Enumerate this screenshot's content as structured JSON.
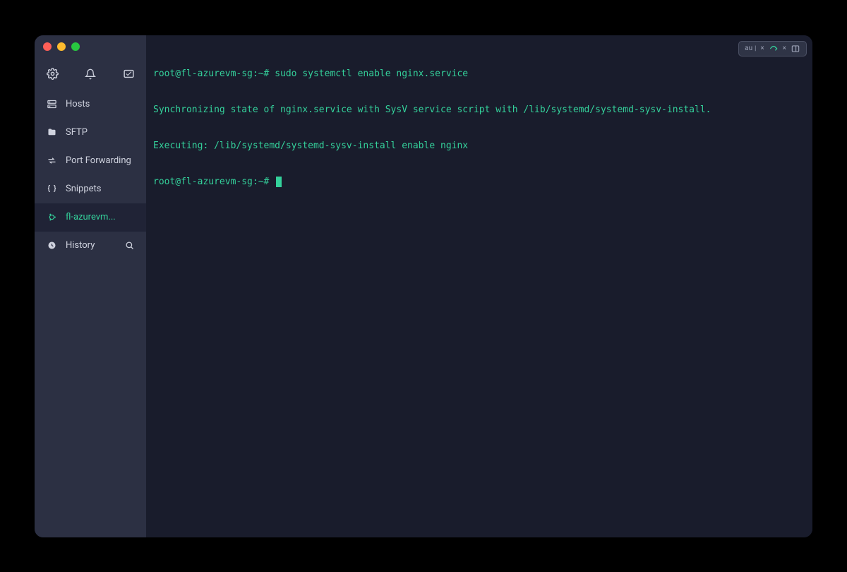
{
  "colors": {
    "bg_outer": "#000000",
    "sidebar_bg": "#2c3043",
    "main_bg": "#191c2c",
    "text_default": "#d0d3df",
    "accent_green": "#34d19b"
  },
  "traffic": {
    "close": "close",
    "minimize": "minimize",
    "maximize": "maximize"
  },
  "top_icons": {
    "settings": "Settings",
    "notifications": "Notifications",
    "snapshot": "Snapshot"
  },
  "sidebar": {
    "items": [
      {
        "id": "hosts",
        "label": "Hosts",
        "active": false
      },
      {
        "id": "sftp",
        "label": "SFTP",
        "active": false
      },
      {
        "id": "port-forwarding",
        "label": "Port Forwarding",
        "active": false
      },
      {
        "id": "snippets",
        "label": "Snippets",
        "active": false
      },
      {
        "id": "connection",
        "label": "fl-azurevm...",
        "active": true
      },
      {
        "id": "history",
        "label": "History",
        "active": false,
        "has_search": true
      }
    ]
  },
  "toolbar": {
    "chip_label": "au",
    "close_label": "×"
  },
  "terminal": {
    "prompt1": "root@fl-azurevm-sg:~# ",
    "command1": "sudo systemctl enable nginx.service",
    "output1": "Synchronizing state of nginx.service with SysV service script with /lib/systemd/systemd-sysv-install.",
    "output2": "Executing: /lib/systemd/systemd-sysv-install enable nginx",
    "prompt2": "root@fl-azurevm-sg:~# "
  }
}
